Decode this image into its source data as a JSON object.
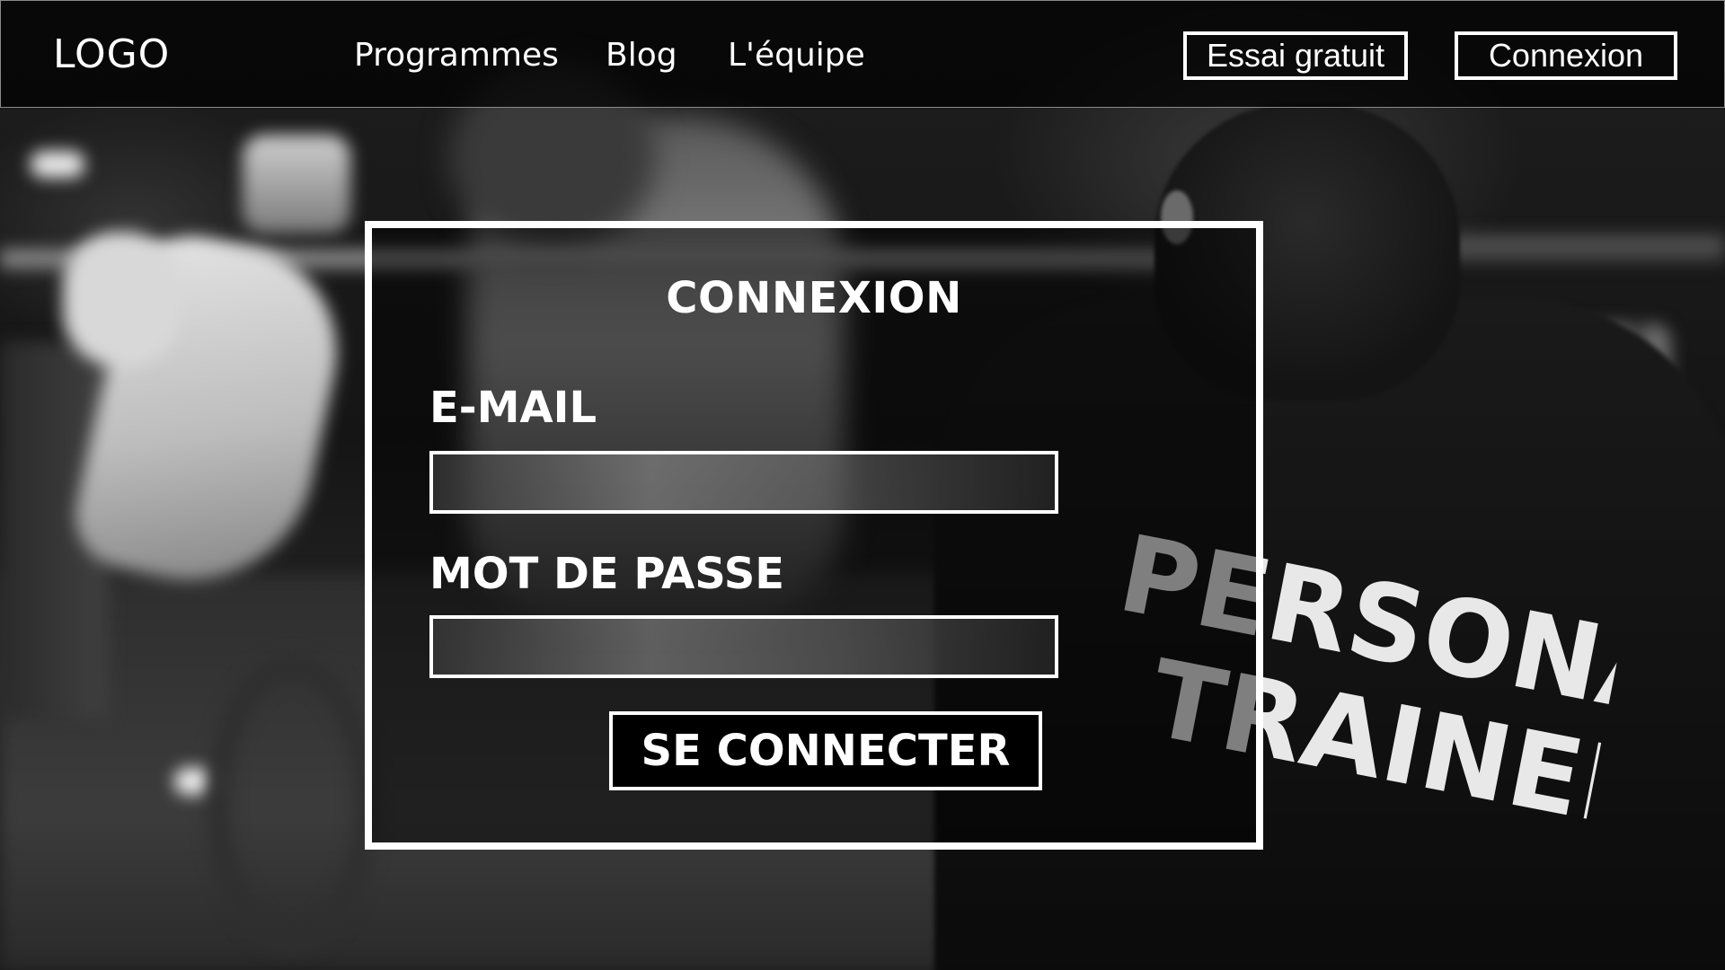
{
  "header": {
    "logo": "LOGO",
    "nav": {
      "programmes": "Programmes",
      "blog": "Blog",
      "equipe": "L'équipe"
    },
    "trial_button": "Essai gratuit",
    "login_button": "Connexion"
  },
  "login_card": {
    "title": "CONNEXION",
    "email_label": "E-MAIL",
    "email_value": "",
    "password_label": "MOT DE PASSE",
    "password_value": "",
    "submit_label": "SE CONNECTER"
  },
  "background": {
    "image": "gym-photo",
    "print": "PERSONAL TRAINER"
  },
  "colors": {
    "border": "#ffffff",
    "header_bg": "#000000",
    "text": "#ffffff"
  }
}
